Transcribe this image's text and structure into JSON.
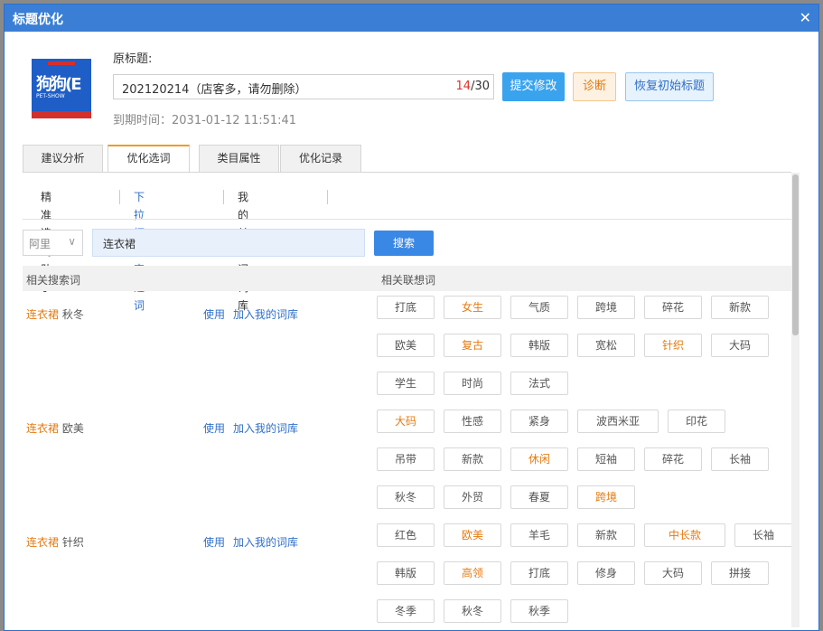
{
  "dialog": {
    "title": "标题优化",
    "close_icon": "close-icon"
  },
  "product": {
    "thumb_big_text": "狗狗(E",
    "thumb_small_text": "PET-SHOW",
    "orig_label": "原标题:",
    "title_value": "202120214（店客多，请勿删除）",
    "count_current": "14",
    "count_total": "/30",
    "expire_text": "到期时间：2031-01-12 11:51:41"
  },
  "buttons": {
    "submit": "提交修改",
    "diagnose": "诊断",
    "restore": "恢复初始标题"
  },
  "tabs": [
    {
      "label": "建议分析",
      "active": false
    },
    {
      "label": "优化选词",
      "active": true
    },
    {
      "label": "类目属性",
      "active": false
    },
    {
      "label": "优化记录",
      "active": false
    }
  ],
  "subtabs": [
    {
      "label": "精准选词助手",
      "active": false
    },
    {
      "label": "下拉框搜索选词",
      "active": true
    },
    {
      "label": "我的关键词词库",
      "active": false
    }
  ],
  "search": {
    "platform": "阿里",
    "platform_chevron_icon": "chevron-down-icon",
    "keyword": "连衣裙",
    "button": "搜索"
  },
  "table": {
    "col1": "相关搜索词",
    "col2": "相关联想词",
    "use_label": "使用",
    "add_label": "加入我的词库",
    "rows": [
      {
        "kw": "连衣裙",
        "suffix": " 秋冬",
        "chips": [
          [
            {
              "t": "打底",
              "hot": false
            },
            {
              "t": "女生",
              "hot": true
            },
            {
              "t": "气质",
              "hot": false
            },
            {
              "t": "跨境",
              "hot": false
            },
            {
              "t": "碎花",
              "hot": false
            },
            {
              "t": "新款",
              "hot": false
            }
          ],
          [
            {
              "t": "欧美",
              "hot": false
            },
            {
              "t": "复古",
              "hot": true
            },
            {
              "t": "韩版",
              "hot": false
            },
            {
              "t": "宽松",
              "hot": false
            },
            {
              "t": "针织",
              "hot": true
            },
            {
              "t": "大码",
              "hot": false
            }
          ],
          [
            {
              "t": "学生",
              "hot": false
            },
            {
              "t": "时尚",
              "hot": false
            },
            {
              "t": "法式",
              "hot": false
            }
          ]
        ]
      },
      {
        "kw": "连衣裙",
        "suffix": " 欧美",
        "chips": [
          [
            {
              "t": "大码",
              "hot": true
            },
            {
              "t": "性感",
              "hot": false
            },
            {
              "t": "紧身",
              "hot": false
            },
            {
              "t": "波西米亚",
              "hot": false,
              "wide": true
            },
            {
              "t": "印花",
              "hot": false
            }
          ],
          [
            {
              "t": "吊带",
              "hot": false
            },
            {
              "t": "新款",
              "hot": false
            },
            {
              "t": "休闲",
              "hot": true
            },
            {
              "t": "短袖",
              "hot": false
            },
            {
              "t": "碎花",
              "hot": false
            },
            {
              "t": "长袖",
              "hot": false
            }
          ],
          [
            {
              "t": "秋冬",
              "hot": false
            },
            {
              "t": "外贸",
              "hot": false
            },
            {
              "t": "春夏",
              "hot": false
            },
            {
              "t": "跨境",
              "hot": true
            }
          ]
        ]
      },
      {
        "kw": "连衣裙",
        "suffix": " 针织",
        "chips": [
          [
            {
              "t": "红色",
              "hot": false
            },
            {
              "t": "欧美",
              "hot": true
            },
            {
              "t": "羊毛",
              "hot": false
            },
            {
              "t": "新款",
              "hot": false
            },
            {
              "t": "中长款",
              "hot": true,
              "wide": true
            },
            {
              "t": "长袖",
              "hot": false
            }
          ],
          [
            {
              "t": "韩版",
              "hot": false
            },
            {
              "t": "高领",
              "hot": true
            },
            {
              "t": "打底",
              "hot": false
            },
            {
              "t": "修身",
              "hot": false
            },
            {
              "t": "大码",
              "hot": false
            },
            {
              "t": "拼接",
              "hot": false
            }
          ],
          [
            {
              "t": "冬季",
              "hot": false
            },
            {
              "t": "秋冬",
              "hot": false
            },
            {
              "t": "秋季",
              "hot": false
            }
          ]
        ]
      }
    ]
  },
  "colors": {
    "accent": "#3a7fd5",
    "hot": "#e57b12",
    "link": "#2f6fc9"
  }
}
